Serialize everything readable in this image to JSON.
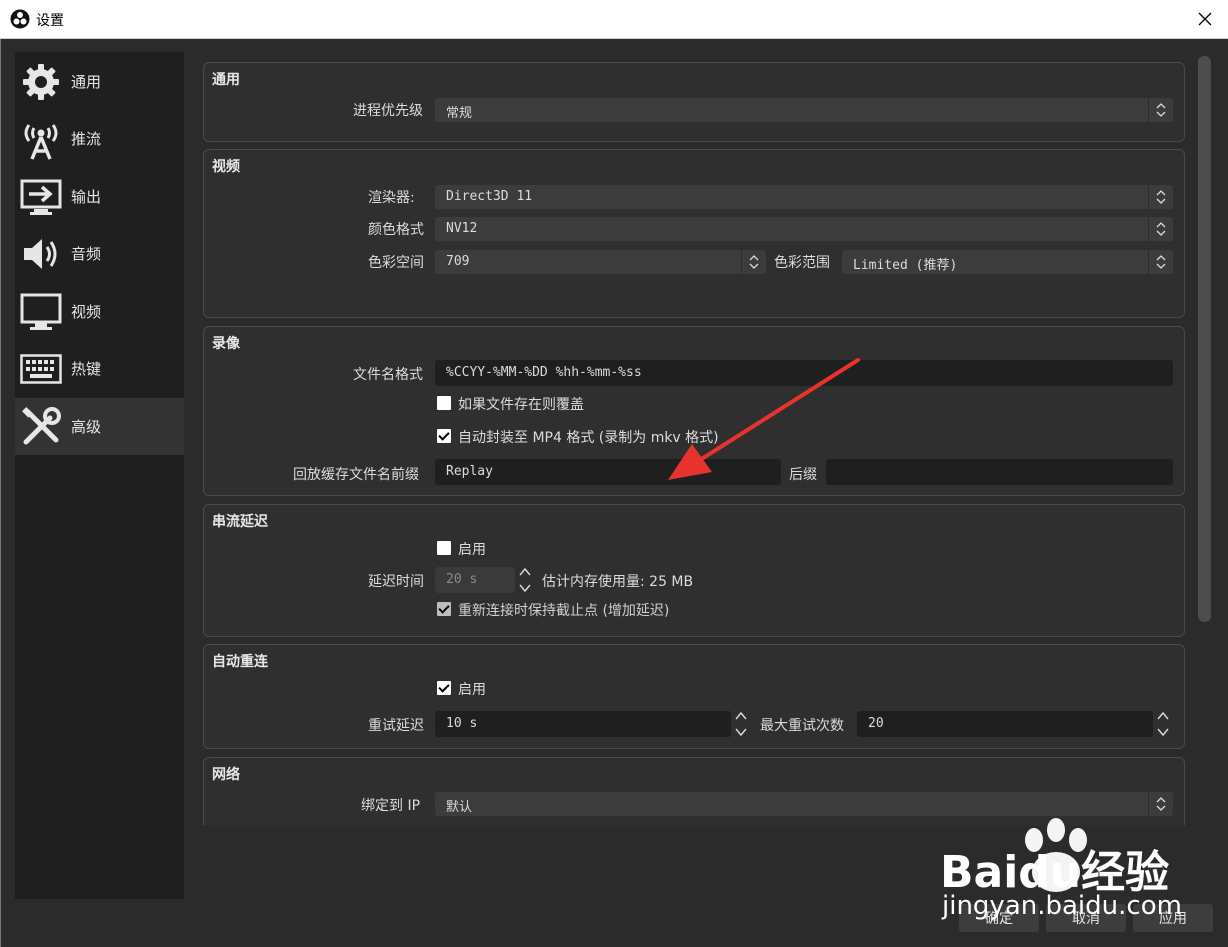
{
  "window": {
    "title": "设置"
  },
  "sidebar": {
    "items": [
      {
        "label": "通用",
        "icon": "gear-icon"
      },
      {
        "label": "推流",
        "icon": "broadcast-icon"
      },
      {
        "label": "输出",
        "icon": "output-icon"
      },
      {
        "label": "音频",
        "icon": "speaker-icon"
      },
      {
        "label": "视频",
        "icon": "monitor-icon"
      },
      {
        "label": "热键",
        "icon": "keyboard-icon"
      },
      {
        "label": "高级",
        "icon": "tools-icon",
        "active": true
      }
    ]
  },
  "general": {
    "title": "通用",
    "priority_label": "进程优先级",
    "priority_value": "常规"
  },
  "video": {
    "title": "视频",
    "renderer_label": "渲染器:",
    "renderer_value": "Direct3D 11",
    "color_format_label": "颜色格式",
    "color_format_value": "NV12",
    "color_space_label": "色彩空间",
    "color_space_value": "709",
    "color_range_label": "色彩范围",
    "color_range_value": "Limited (推荐)"
  },
  "recording": {
    "title": "录像",
    "filename_label": "文件名格式",
    "filename_value": "%CCYY-%MM-%DD %hh-%mm-%ss",
    "overwrite_label": "如果文件存在则覆盖",
    "overwrite_checked": false,
    "remux_label": "自动封装至 MP4 格式 (录制为 mkv 格式)",
    "remux_checked": true,
    "replay_prefix_label": "回放缓存文件名前缀",
    "replay_prefix_value": "Replay",
    "suffix_label": "后缀",
    "suffix_value": ""
  },
  "stream_delay": {
    "title": "串流延迟",
    "enable_label": "启用",
    "enable_checked": false,
    "delay_label": "延迟时间",
    "delay_value": "20 s",
    "memory_label": "估计内存使用量: 25 MB",
    "preserve_label": "重新连接时保持截止点 (增加延迟)",
    "preserve_checked": true
  },
  "reconnect": {
    "title": "自动重连",
    "enable_label": "启用",
    "enable_checked": true,
    "retry_delay_label": "重试延迟",
    "retry_delay_value": "10 s",
    "max_retries_label": "最大重试次数",
    "max_retries_value": "20"
  },
  "network": {
    "title": "网络",
    "bind_ip_label": "绑定到 IP",
    "bind_ip_value": "默认"
  },
  "footer": {
    "ok_label": "确定",
    "cancel_label": "取消",
    "apply_label": "应用"
  },
  "watermark": {
    "brand": "Baidu经验",
    "url": "jingyan.baidu.com"
  },
  "colors": {
    "annotation_arrow": "#e8322e",
    "background": "#2b2b2b",
    "sidebar": "#1f1f1f"
  }
}
